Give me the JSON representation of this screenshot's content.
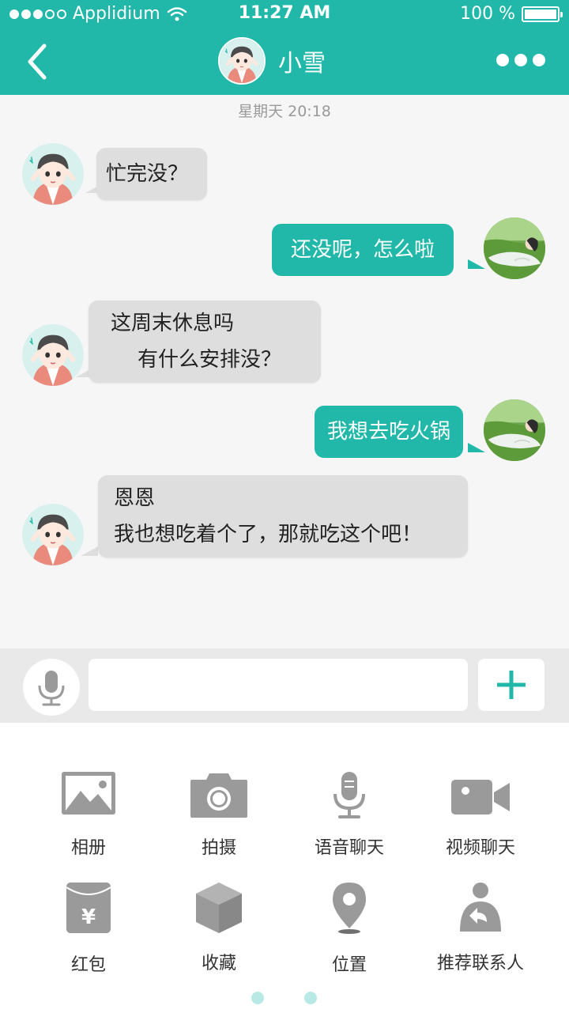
{
  "status_bar": {
    "carrier": "Applidium",
    "time": "11:27 AM",
    "battery": "100 %"
  },
  "nav": {
    "title": "小雪"
  },
  "chat": {
    "timestamp": "星期天 20:18",
    "messages": [
      {
        "direction": "incoming",
        "lines": [
          "忙完没？"
        ]
      },
      {
        "direction": "outgoing",
        "lines": [
          "还没呢，怎么啦"
        ]
      },
      {
        "direction": "incoming",
        "lines": [
          "这周末休息吗",
          "有什么安排没？"
        ]
      },
      {
        "direction": "outgoing",
        "lines": [
          "我想去吃火锅"
        ]
      },
      {
        "direction": "incoming",
        "lines": [
          "恩恩",
          "我也想吃着个了，那就吃这个吧！"
        ]
      }
    ]
  },
  "input": {
    "placeholder": ""
  },
  "panel": {
    "items": [
      {
        "label": "相册",
        "icon": "photo-album-icon"
      },
      {
        "label": "拍摄",
        "icon": "camera-icon"
      },
      {
        "label": "语音聊天",
        "icon": "microphone-icon"
      },
      {
        "label": "视频聊天",
        "icon": "video-camera-icon"
      },
      {
        "label": "红包",
        "icon": "red-envelope-icon"
      },
      {
        "label": "收藏",
        "icon": "box-icon"
      },
      {
        "label": "位置",
        "icon": "location-pin-icon"
      },
      {
        "label": "推荐联系人",
        "icon": "share-contact-icon"
      }
    ],
    "page_count": 2
  },
  "colors": {
    "accent": "#21b8a9",
    "incoming_bubble": "#dedede",
    "icon_gray": "#9a9a9a"
  }
}
